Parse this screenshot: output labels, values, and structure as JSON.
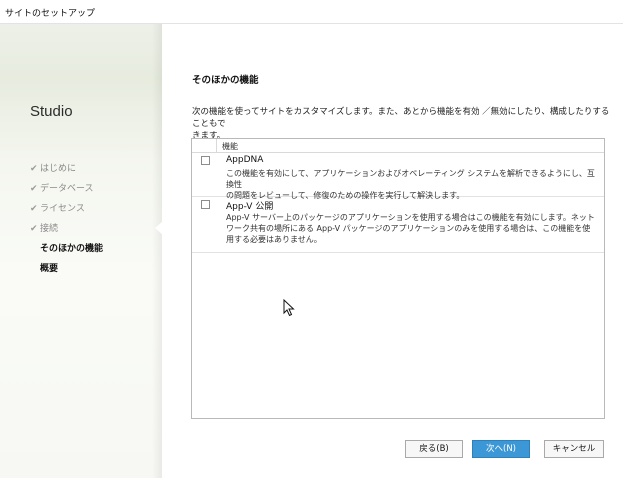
{
  "window": {
    "title": "サイトのセットアップ"
  },
  "sidebar": {
    "app_name": "Studio",
    "steps": [
      {
        "label": "はじめに",
        "done": true
      },
      {
        "label": "データベース",
        "done": true
      },
      {
        "label": "ライセンス",
        "done": true
      },
      {
        "label": "接続",
        "done": true
      },
      {
        "label": "そのほかの機能",
        "current": true
      },
      {
        "label": "概要"
      }
    ],
    "check_glyph": "✔"
  },
  "main": {
    "heading": "そのほかの機能",
    "description_line1": "次の機能を使ってサイトをカスタマイズします。また、あとから機能を有効 ／無効にしたり、構成したりすることもで",
    "description_line2": "きます。",
    "list": {
      "column_header": "機能",
      "items": [
        {
          "name": "AppDNA",
          "desc_line1": "この機能を有効にして、アプリケーションおよびオペレーティング システムを解析できるようにし、互換性",
          "desc_line2": "の問題をレビューして、修復のための操作を実行して解決します。",
          "checked": false
        },
        {
          "name": "App-V 公開",
          "desc_line1": "App-V サーバー上のパッケージのアプリケーションを使用する場合はこの機能を有効にします。ネット",
          "desc_line2": "ワーク共有の場所にある App-V パッケージのアプリケーションのみを使用する場合は、この機能を使",
          "desc_line3": "用する必要はありません。",
          "checked": false
        }
      ]
    }
  },
  "buttons": {
    "back": "戻る(B)",
    "next": "次へ(N)",
    "cancel": "キャンセル"
  },
  "colors": {
    "accent": "#3c97d6",
    "sidebar_bg": "#eef1e9"
  }
}
